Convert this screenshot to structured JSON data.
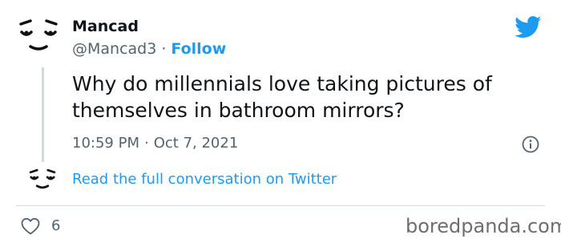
{
  "author": {
    "name": "Mancad",
    "handle": "@Mancad3",
    "separator": "·",
    "follow_label": "Follow",
    "avatar_icon": "face-icon"
  },
  "tweet": {
    "text": "Why do millennials love taking pictures of themselves in bathroom mirrors?",
    "time": "10:59 PM",
    "separator": "·",
    "date": "Oct 7, 2021"
  },
  "conversation": {
    "link_label": "Read the full conversation on Twitter"
  },
  "actions": {
    "likes": "6",
    "like_icon": "heart-icon"
  },
  "watermark": "boredpanda.com",
  "colors": {
    "accent": "#1d9bf0",
    "secondary_text": "#536471",
    "primary_text": "#0f1419",
    "divider": "#cfd9de"
  }
}
